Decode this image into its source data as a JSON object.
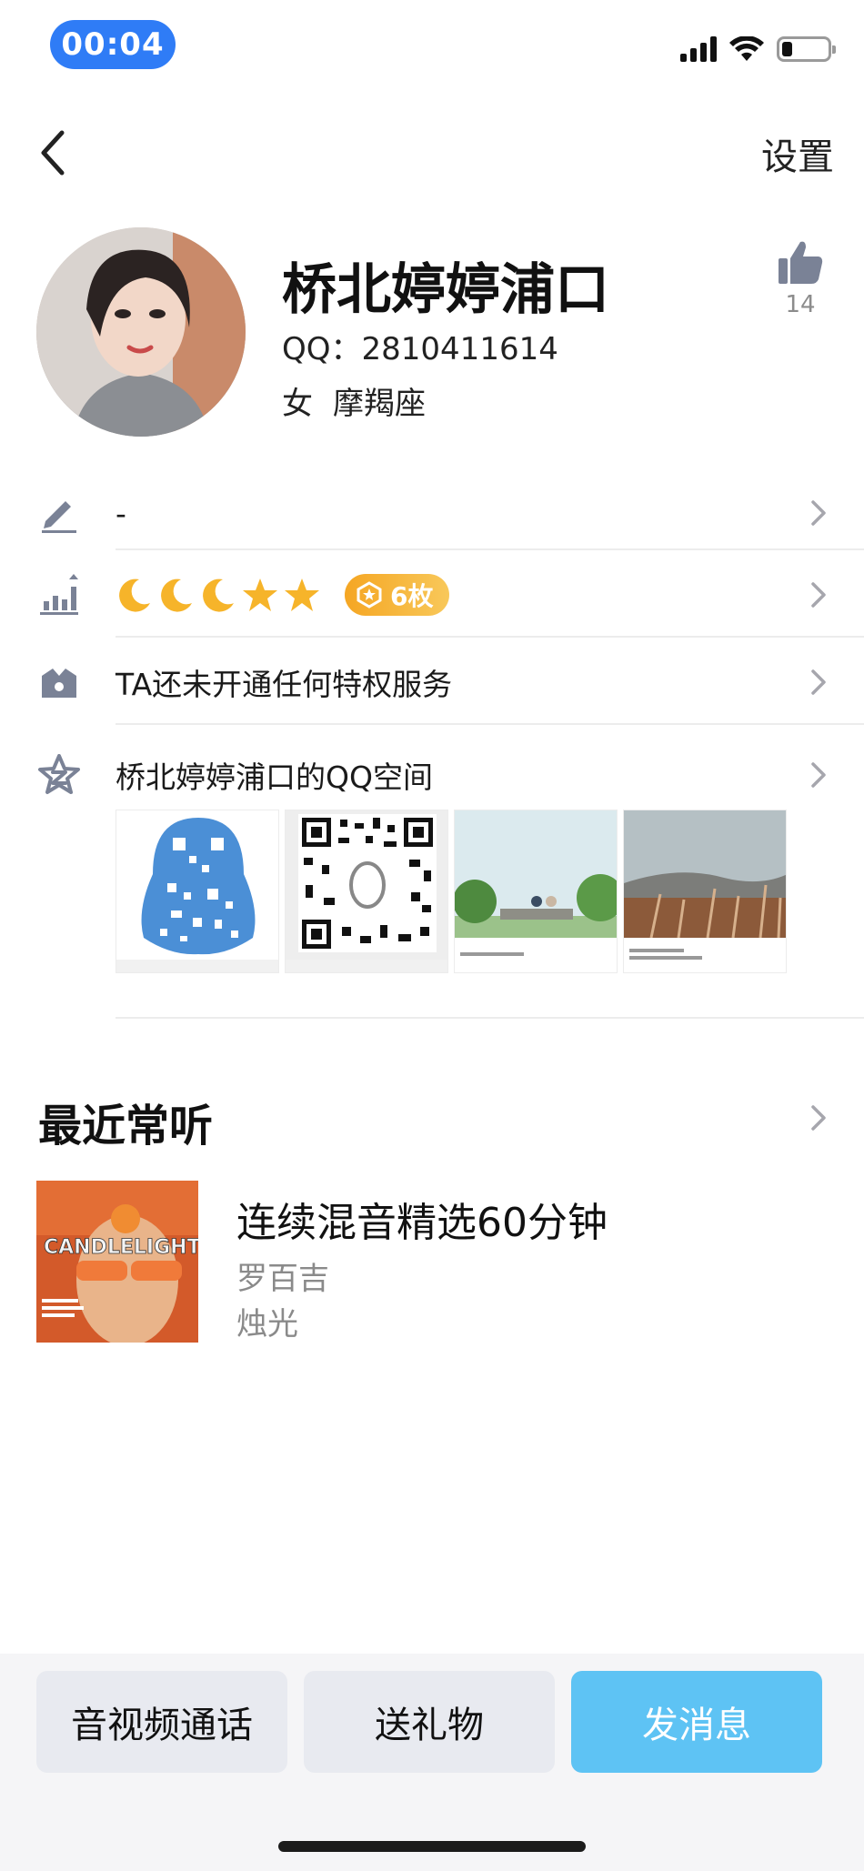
{
  "status_bar": {
    "time": "00:04",
    "battery_level": 0.22
  },
  "nav": {
    "settings_label": "设置"
  },
  "profile": {
    "nickname": "桥北婷婷浦口",
    "qq_label": "QQ：2810411614",
    "gender": "女",
    "zodiac": "摩羯座",
    "like_count": "14"
  },
  "rows": {
    "signature": "-",
    "level_medal_count": "6枚",
    "privilege": "TA还未开通任何特权服务",
    "qzone": "桥北婷婷浦口的QQ空间"
  },
  "qzone_thumbs": [
    {
      "name": "qzone-thumb-qr-penguin"
    },
    {
      "name": "qzone-thumb-qr-code"
    },
    {
      "name": "qzone-thumb-trees"
    },
    {
      "name": "qzone-thumb-reeds"
    }
  ],
  "music": {
    "section_title": "最近常听",
    "song_title": "连续混音精选60分钟",
    "artist": "罗百吉",
    "album": "烛光",
    "album_art_text": "CANDLELIGHT"
  },
  "actions": {
    "call_label": "音视频通话",
    "gift_label": "送礼物",
    "message_label": "发消息"
  },
  "colors": {
    "status_pill": "#2f7cf6",
    "message_button": "#5ec3f4",
    "medal_badge": "#f5a623",
    "icon_gray": "#7a8296"
  }
}
